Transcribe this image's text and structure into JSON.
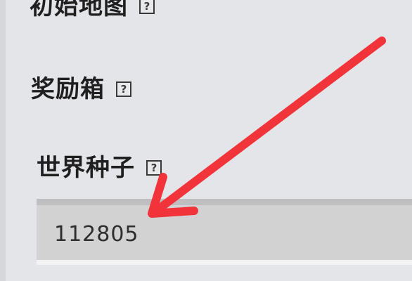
{
  "form": {
    "initial_map_label": "初始地图",
    "reward_box_label": "奖励箱",
    "world_seed_label": "世界种子",
    "help_glyph": "?",
    "world_seed_value": "112805"
  },
  "colors": {
    "background": "#e4e5e9",
    "field": "#d2d2d3",
    "arrow": "#f1343a"
  },
  "icons": {
    "help": "question-box-icon",
    "annotation": "red-arrow-icon"
  }
}
